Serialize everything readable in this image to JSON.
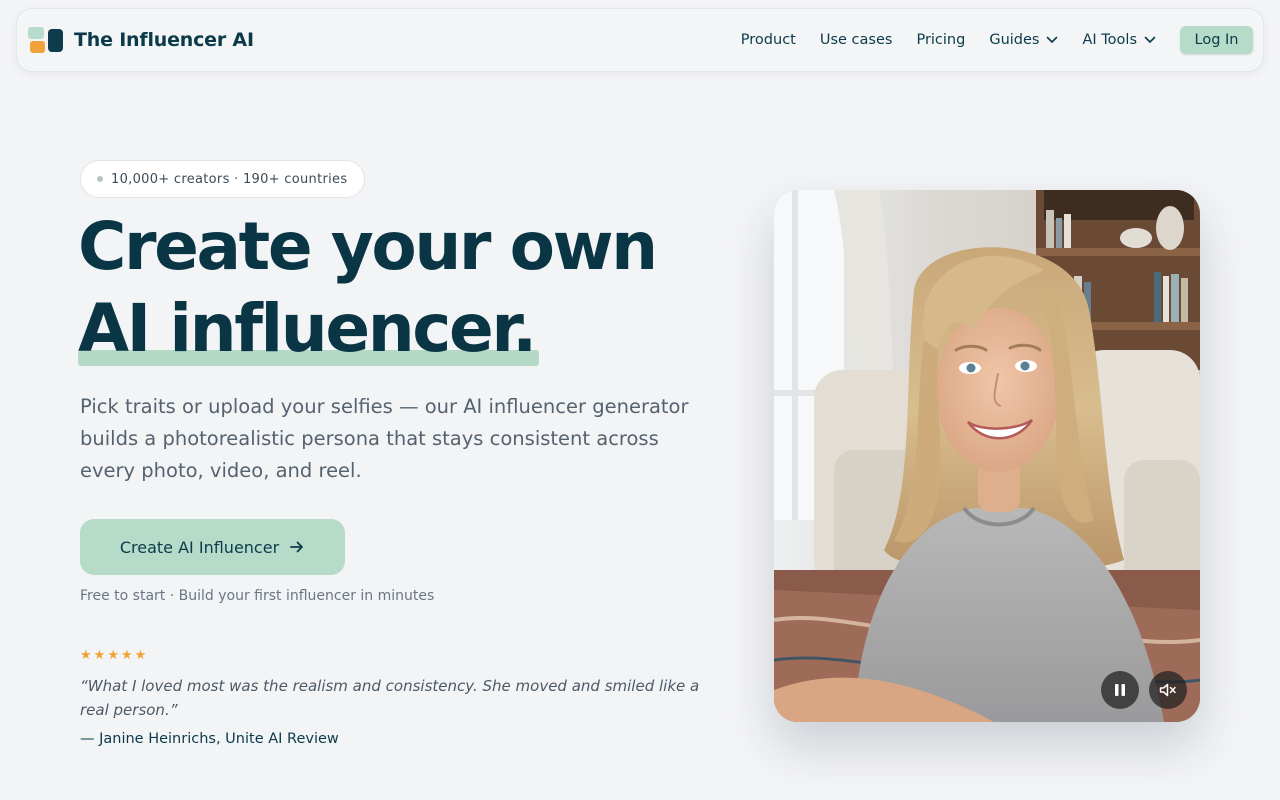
{
  "brand": {
    "name": "The Influencer AI"
  },
  "nav": {
    "links": [
      {
        "label": "Product"
      },
      {
        "label": "Use cases"
      },
      {
        "label": "Pricing"
      },
      {
        "label": "Guides",
        "dropdown": true
      },
      {
        "label": "AI Tools",
        "dropdown": true
      }
    ],
    "login_label": "Log In"
  },
  "hero": {
    "badge": "10,000+ creators · 190+ countries",
    "title_line1": "Create your own",
    "title_line2": "AI influencer.",
    "lead": "Pick traits or upload your selfies — our AI influencer generator builds a photorealistic persona that stays consistent across every photo, video, and reel.",
    "cta_label": "Create AI Influencer",
    "cta_note": "Free to start · Build your first influencer in minutes",
    "rating_stars": 5,
    "testimonial": "“What I loved most was the realism and consistency. She moved and smiled like a real person.”",
    "testimonial_author": "— Janine Heinrichs, Unite AI Review"
  },
  "video": {
    "subject": "smiling blonde woman in grey sweatshirt sitting in living room",
    "controls": {
      "pause_icon": "pause-icon",
      "mute_icon": "mute-icon"
    }
  },
  "colors": {
    "accent": "#b6dbc9",
    "brand_dark": "#0b3a4a",
    "star": "#f0a234",
    "background": "#f3f4f6"
  }
}
